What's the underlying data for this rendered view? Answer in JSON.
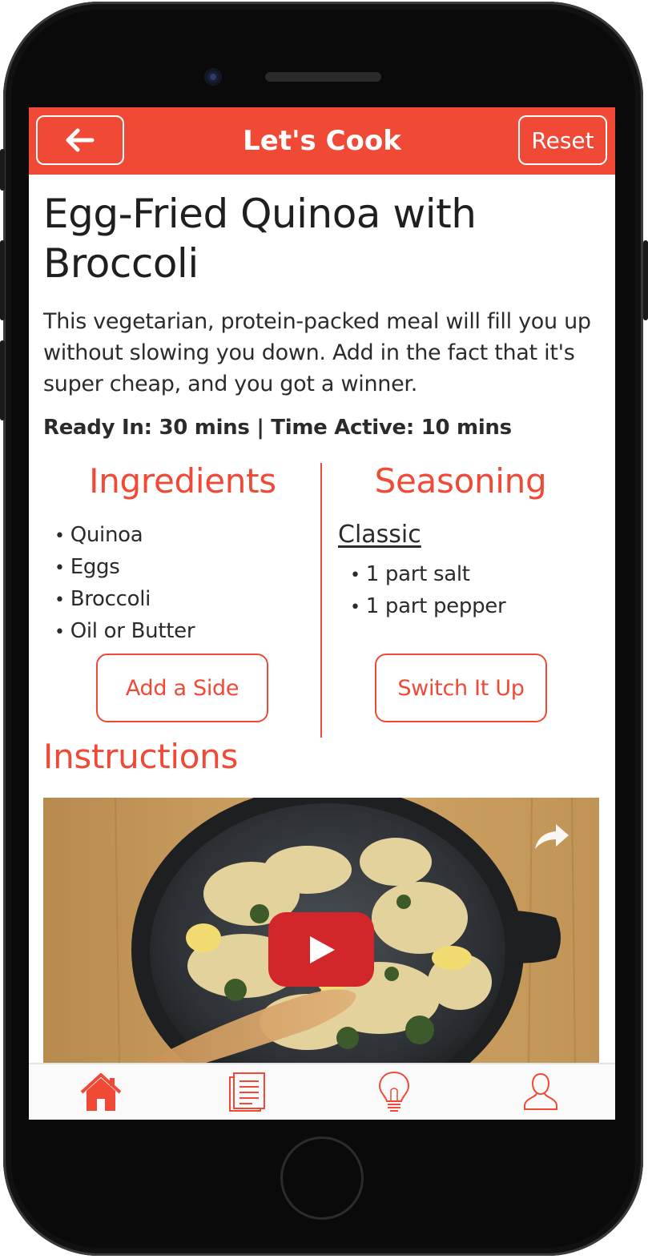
{
  "header": {
    "title": "Let's Cook",
    "reset_label": "Reset"
  },
  "recipe": {
    "title": "Egg-Fried Quinoa with Broccoli",
    "description": "This vegetarian, protein-packed meal will fill you up without slowing you down. Add in the fact that it's super cheap, and you got a winner.",
    "times": "Ready In: 30 mins | Time Active: 10 mins"
  },
  "ingredients": {
    "heading": "Ingredients",
    "items": [
      "Quinoa",
      "Eggs",
      "Broccoli",
      "Oil or Butter"
    ],
    "button_label": "Add a Side"
  },
  "seasoning": {
    "heading": "Seasoning",
    "style": "Classic",
    "items": [
      "1 part salt",
      "1 part pepper"
    ],
    "button_label": "Switch It Up"
  },
  "instructions": {
    "heading": "Instructions"
  },
  "icons": {
    "back": "arrow-left-icon",
    "share": "share-icon",
    "play": "play-icon",
    "home": "home-icon",
    "recipes": "list-document-icon",
    "ideas": "lightbulb-icon",
    "profile": "user-icon"
  },
  "colors": {
    "accent": "#f04a37",
    "play": "#d3262b",
    "text": "#2b2b2b"
  }
}
